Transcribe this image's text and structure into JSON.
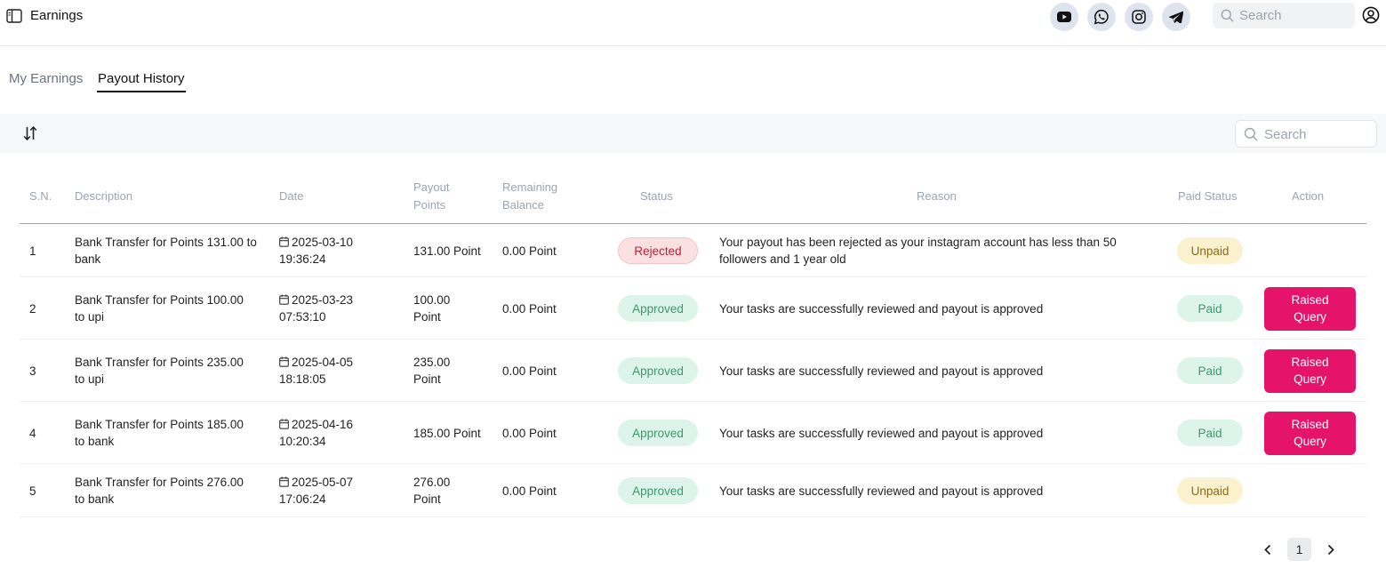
{
  "header": {
    "title": "Earnings",
    "social": [
      "youtube-icon",
      "whatsapp-icon",
      "instagram-icon",
      "telegram-icon"
    ],
    "search_placeholder": "Search"
  },
  "tabs": [
    {
      "label": "My Earnings",
      "active": false
    },
    {
      "label": "Payout History",
      "active": true
    }
  ],
  "toolbar": {
    "search_placeholder": "Search"
  },
  "table": {
    "columns": {
      "sn": "S.N.",
      "description": "Description",
      "date": "Date",
      "payout_1": "Payout",
      "payout_2": "Points",
      "remaining_1": "Remaining",
      "remaining_2": "Balance",
      "status": "Status",
      "reason": "Reason",
      "paid_status": "Paid Status",
      "action": "Action"
    },
    "rows": [
      {
        "sn": "1",
        "desc1": "Bank Transfer for Points 131.00 to",
        "desc2": "bank",
        "date1": "2025-03-10",
        "date2": "19:36:24",
        "points1": "131.00 Point",
        "points2": "",
        "balance": "0.00 Point",
        "status": "Rejected",
        "reason1": "Your payout has been rejected as your instagram account has less than 50",
        "reason2": "followers and 1 year old",
        "paid_status": "Unpaid",
        "action1": "",
        "action2": ""
      },
      {
        "sn": "2",
        "desc1": "Bank Transfer for Points 100.00",
        "desc2": "to upi",
        "date1": "2025-03-23",
        "date2": "07:53:10",
        "points1": "100.00",
        "points2": "Point",
        "balance": "0.00 Point",
        "status": "Approved",
        "reason1": "Your tasks are successfully reviewed and payout is approved",
        "reason2": "",
        "paid_status": "Paid",
        "action1": "Raised",
        "action2": "Query"
      },
      {
        "sn": "3",
        "desc1": "Bank Transfer for Points 235.00",
        "desc2": "to upi",
        "date1": "2025-04-05",
        "date2": "18:18:05",
        "points1": "235.00",
        "points2": "Point",
        "balance": "0.00 Point",
        "status": "Approved",
        "reason1": "Your tasks are successfully reviewed and payout is approved",
        "reason2": "",
        "paid_status": "Paid",
        "action1": "Raised",
        "action2": "Query"
      },
      {
        "sn": "4",
        "desc1": "Bank Transfer for Points 185.00",
        "desc2": "to bank",
        "date1": "2025-04-16",
        "date2": "10:20:34",
        "points1": "185.00 Point",
        "points2": "",
        "balance": "0.00 Point",
        "status": "Approved",
        "reason1": "Your tasks are successfully reviewed and payout is approved",
        "reason2": "",
        "paid_status": "Paid",
        "action1": "Raised",
        "action2": "Query"
      },
      {
        "sn": "5",
        "desc1": "Bank Transfer for Points 276.00",
        "desc2": "to bank",
        "date1": "2025-05-07",
        "date2": "17:06:24",
        "points1": "276.00",
        "points2": "Point",
        "balance": "0.00 Point",
        "status": "Approved",
        "reason1": "Your tasks are successfully reviewed and payout is approved",
        "reason2": "",
        "paid_status": "Unpaid",
        "action1": "",
        "action2": ""
      }
    ]
  },
  "pagination": {
    "current_page": "1"
  },
  "colors": {
    "accent": "#e6136b",
    "approved_bg": "#dcf4ea",
    "rejected_bg": "#fbe0e2",
    "unpaid_bg": "#fbf1cf"
  }
}
